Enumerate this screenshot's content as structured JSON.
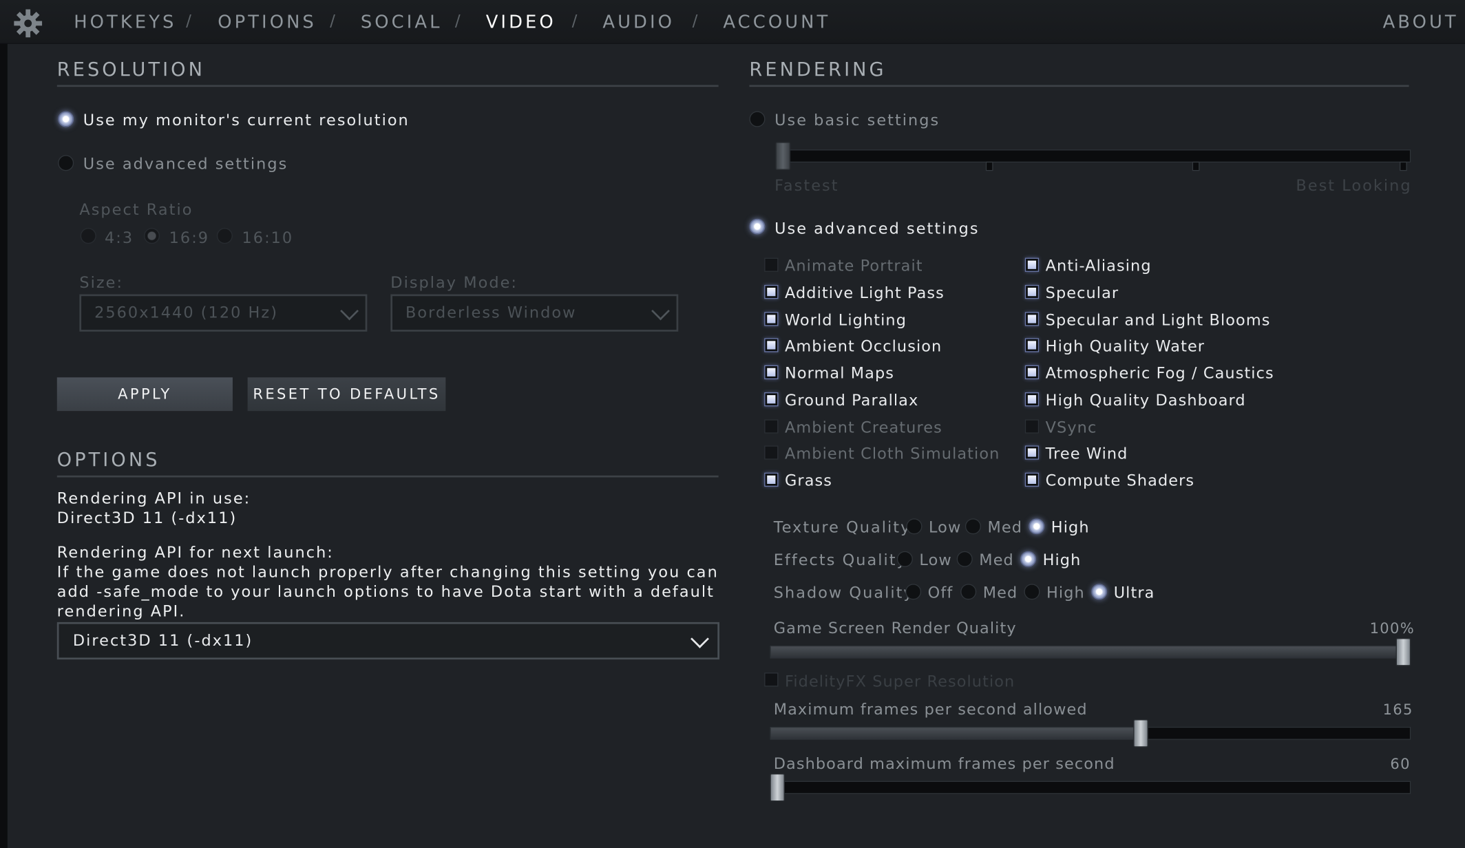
{
  "nav": {
    "tabs": [
      "HOTKEYS",
      "OPTIONS",
      "SOCIAL",
      "VIDEO",
      "AUDIO",
      "ACCOUNT"
    ],
    "separator": "/",
    "active_tab": "VIDEO",
    "about": "ABOUT"
  },
  "resolution": {
    "title": "RESOLUTION",
    "use_monitor_label": "Use my monitor's current resolution",
    "use_advanced_label": "Use advanced settings",
    "selected": "monitor",
    "aspect_ratio_label": "Aspect Ratio",
    "aspect_options": [
      "4:3",
      "16:9",
      "16:10"
    ],
    "aspect_selected": "16:9",
    "size_label": "Size:",
    "size_value": "2560x1440 (120 Hz)",
    "display_mode_label": "Display Mode:",
    "display_mode_value": "Borderless Window",
    "apply_label": "APPLY",
    "reset_label": "RESET TO DEFAULTS"
  },
  "options": {
    "title": "OPTIONS",
    "api_in_use_label": "Rendering API in use:",
    "api_in_use_value": "Direct3D 11 (-dx11)",
    "api_next_label": "Rendering API for next launch:",
    "api_next_note_1": "If the game does not launch properly after changing this setting you can",
    "api_next_note_2": "add -safe_mode to your launch options to have Dota start with a default",
    "api_next_note_3": "rendering API.",
    "api_next_value": "Direct3D 11 (-dx11)"
  },
  "rendering": {
    "title": "RENDERING",
    "basic_label": "Use basic settings",
    "basic_slider_min_label": "Fastest",
    "basic_slider_max_label": "Best Looking",
    "basic_slider_level": 0,
    "advanced_label": "Use advanced settings",
    "selected": "advanced",
    "checkboxes_left": [
      {
        "label": "Animate Portrait",
        "checked": false
      },
      {
        "label": "Additive Light Pass",
        "checked": true
      },
      {
        "label": "World Lighting",
        "checked": true
      },
      {
        "label": "Ambient Occlusion",
        "checked": true
      },
      {
        "label": "Normal Maps",
        "checked": true
      },
      {
        "label": "Ground Parallax",
        "checked": true
      },
      {
        "label": "Ambient Creatures",
        "checked": false
      },
      {
        "label": "Ambient Cloth Simulation",
        "checked": false
      },
      {
        "label": "Grass",
        "checked": true
      }
    ],
    "checkboxes_right": [
      {
        "label": "Anti-Aliasing",
        "checked": true
      },
      {
        "label": "Specular",
        "checked": true
      },
      {
        "label": "Specular and Light Blooms",
        "checked": true
      },
      {
        "label": "High Quality Water",
        "checked": true
      },
      {
        "label": "Atmospheric Fog / Caustics",
        "checked": true
      },
      {
        "label": "High Quality Dashboard",
        "checked": true
      },
      {
        "label": "VSync",
        "checked": false
      },
      {
        "label": "Tree Wind",
        "checked": true
      },
      {
        "label": "Compute Shaders",
        "checked": true
      }
    ],
    "texture_quality_label": "Texture Quality",
    "texture_quality_options": [
      "Low",
      "Med",
      "High"
    ],
    "texture_quality_selected": "High",
    "effects_quality_label": "Effects Quality",
    "effects_quality_options": [
      "Low",
      "Med",
      "High"
    ],
    "effects_quality_selected": "High",
    "shadow_quality_label": "Shadow Quality",
    "shadow_quality_options": [
      "Off",
      "Med",
      "High",
      "Ultra"
    ],
    "shadow_quality_selected": "Ultra",
    "render_quality_label": "Game Screen Render Quality",
    "render_quality_value": "100%",
    "render_quality_fraction": 1.0,
    "fsr_label": "FidelityFX Super Resolution",
    "fsr_checked": false,
    "max_fps_label": "Maximum frames per second allowed",
    "max_fps_value": "165",
    "max_fps_fraction": 0.58,
    "dash_fps_label": "Dashboard maximum frames per second",
    "dash_fps_value": "60",
    "dash_fps_fraction": 0.0
  },
  "colors": {
    "background": "#1f2226",
    "accent_radio": "#c3cde8",
    "text": "#e9ebed",
    "muted_text": "#8a9095"
  }
}
